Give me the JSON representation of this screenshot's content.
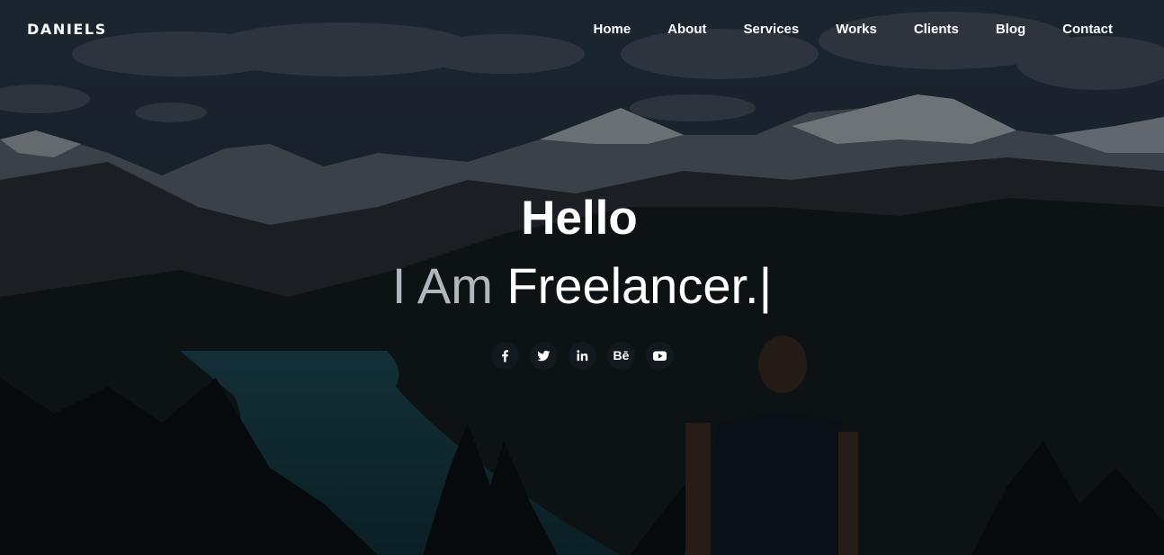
{
  "brand": "DANIELS",
  "nav": {
    "items": [
      {
        "label": "Home"
      },
      {
        "label": "About"
      },
      {
        "label": "Services"
      },
      {
        "label": "Works"
      },
      {
        "label": "Clients"
      },
      {
        "label": "Blog"
      },
      {
        "label": "Contact"
      }
    ]
  },
  "hero": {
    "greeting": "Hello",
    "prefix": "I Am ",
    "typed_text": "Freelancer.",
    "cursor": "|"
  },
  "social": {
    "icons": [
      "facebook-icon",
      "twitter-icon",
      "linkedin-icon",
      "behance-icon",
      "youtube-icon"
    ],
    "behance_glyph": "Bē"
  },
  "colors": {
    "text": "#ffffff",
    "muted_text": "#b0b8bd",
    "social_bg": "#121a20"
  }
}
